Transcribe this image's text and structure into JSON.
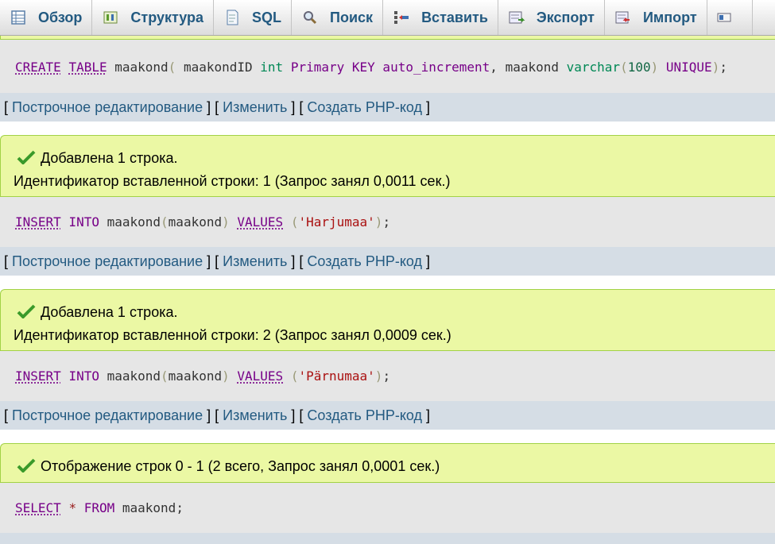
{
  "tabs": [
    {
      "label": "Обзор",
      "icon": "browse-icon"
    },
    {
      "label": "Структура",
      "icon": "structure-icon"
    },
    {
      "label": "SQL",
      "icon": "sql-icon"
    },
    {
      "label": "Поиск",
      "icon": "search-icon"
    },
    {
      "label": "Вставить",
      "icon": "insert-icon"
    },
    {
      "label": "Экспорт",
      "icon": "export-icon"
    },
    {
      "label": "Импорт",
      "icon": "import-icon"
    }
  ],
  "actions": {
    "inline_edit": "Построчное редактирование",
    "edit": "Изменить",
    "create_php": "Создать PHP-код",
    "open": "[",
    "mid": "] [",
    "close": "]"
  },
  "blocks": [
    {
      "query": {
        "tokens": [
          {
            "t": "CREATE",
            "c": "kw"
          },
          {
            "t": " ",
            "c": ""
          },
          {
            "t": "TABLE",
            "c": "kw"
          },
          {
            "t": " maakond",
            "c": "id"
          },
          {
            "t": "(",
            "c": "br"
          },
          {
            "t": " maakondID ",
            "c": "id"
          },
          {
            "t": "int",
            "c": "ty"
          },
          {
            "t": " ",
            "c": ""
          },
          {
            "t": "Primary KEY",
            "c": "kw-plain"
          },
          {
            "t": " auto_increment",
            "c": "kw-plain"
          },
          {
            "t": ", maakond ",
            "c": "id"
          },
          {
            "t": "varchar",
            "c": "ty"
          },
          {
            "t": "(",
            "c": "br"
          },
          {
            "t": "100",
            "c": "num"
          },
          {
            "t": ")",
            "c": "br"
          },
          {
            "t": " ",
            "c": ""
          },
          {
            "t": "UNIQUE",
            "c": "kw-plain"
          },
          {
            "t": ")",
            "c": "br"
          },
          {
            "t": ";",
            "c": "id"
          }
        ]
      }
    },
    {
      "message": "Добавлена 1 строка.",
      "detail": "Идентификатор вставленной строки: 1 (Запрос занял 0,0011 сек.)",
      "query": {
        "tokens": [
          {
            "t": "INSERT",
            "c": "kw"
          },
          {
            "t": " ",
            "c": ""
          },
          {
            "t": "INTO",
            "c": "kw-plain"
          },
          {
            "t": " maakond",
            "c": "id"
          },
          {
            "t": "(",
            "c": "br"
          },
          {
            "t": "maakond",
            "c": "id"
          },
          {
            "t": ")",
            "c": "br"
          },
          {
            "t": " ",
            "c": ""
          },
          {
            "t": "VALUES",
            "c": "kw"
          },
          {
            "t": " ",
            "c": ""
          },
          {
            "t": "(",
            "c": "br"
          },
          {
            "t": "'Harjumaa'",
            "c": "str"
          },
          {
            "t": ")",
            "c": "br"
          },
          {
            "t": ";",
            "c": "id"
          }
        ]
      }
    },
    {
      "message": "Добавлена 1 строка.",
      "detail": "Идентификатор вставленной строки: 2 (Запрос занял 0,0009 сек.)",
      "query": {
        "tokens": [
          {
            "t": "INSERT",
            "c": "kw"
          },
          {
            "t": " ",
            "c": ""
          },
          {
            "t": "INTO",
            "c": "kw-plain"
          },
          {
            "t": " maakond",
            "c": "id"
          },
          {
            "t": "(",
            "c": "br"
          },
          {
            "t": "maakond",
            "c": "id"
          },
          {
            "t": ")",
            "c": "br"
          },
          {
            "t": " ",
            "c": ""
          },
          {
            "t": "VALUES",
            "c": "kw"
          },
          {
            "t": " ",
            "c": ""
          },
          {
            "t": "(",
            "c": "br"
          },
          {
            "t": "'Pärnumaa'",
            "c": "str"
          },
          {
            "t": ")",
            "c": "br"
          },
          {
            "t": ";",
            "c": "id"
          }
        ]
      }
    },
    {
      "message": "Отображение строк 0 - 1 (2 всего, Запрос занял 0,0001 сек.)",
      "query": {
        "tokens": [
          {
            "t": "SELECT",
            "c": "kw"
          },
          {
            "t": " ",
            "c": ""
          },
          {
            "t": "*",
            "c": "op"
          },
          {
            "t": " ",
            "c": ""
          },
          {
            "t": "FROM",
            "c": "kw-plain"
          },
          {
            "t": " maakond",
            "c": "id"
          },
          {
            "t": ";",
            "c": "id"
          }
        ]
      }
    }
  ],
  "colors": {
    "success_bg": "#ebf8a4",
    "sql_bg": "#e6e6e6",
    "actions_bg": "#d5dde5",
    "link": "#235a81",
    "keyword": "#770088"
  }
}
